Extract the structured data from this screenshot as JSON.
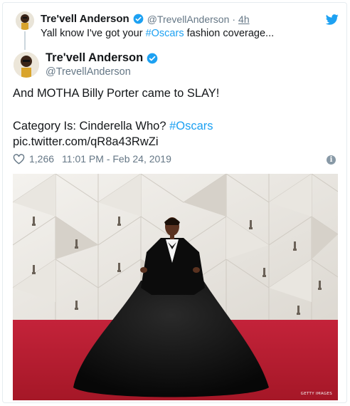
{
  "reply": {
    "name": "Tre'vell Anderson",
    "handle": "@TrevellAnderson",
    "separator": "·",
    "time": "4h",
    "text_before": "Yall know I've got your ",
    "hashtag": "#Oscars",
    "text_after": " fashion coverage..."
  },
  "tweet": {
    "name": "Tre'vell Anderson",
    "handle": "@TrevellAnderson",
    "line1": "And MOTHA Billy Porter came to SLAY!",
    "line2_text": "Category Is: Cinderella Who? ",
    "line2_hashtag": "#Oscars",
    "pic_link": "pic.twitter.com/qR8a43RwZi",
    "likes": "1,266",
    "timestamp": "11:01 PM - Feb 24, 2019",
    "info_glyph": "i"
  },
  "photo": {
    "credit": "GETTY IMAGES"
  },
  "colors": {
    "accent": "#1da1f2",
    "secondary_text": "#657786",
    "carpet": "#b11c2b"
  },
  "icons": {
    "logo": "twitter-bird-icon",
    "verified": "verified-badge-icon",
    "like": "heart-icon",
    "info": "info-icon"
  }
}
